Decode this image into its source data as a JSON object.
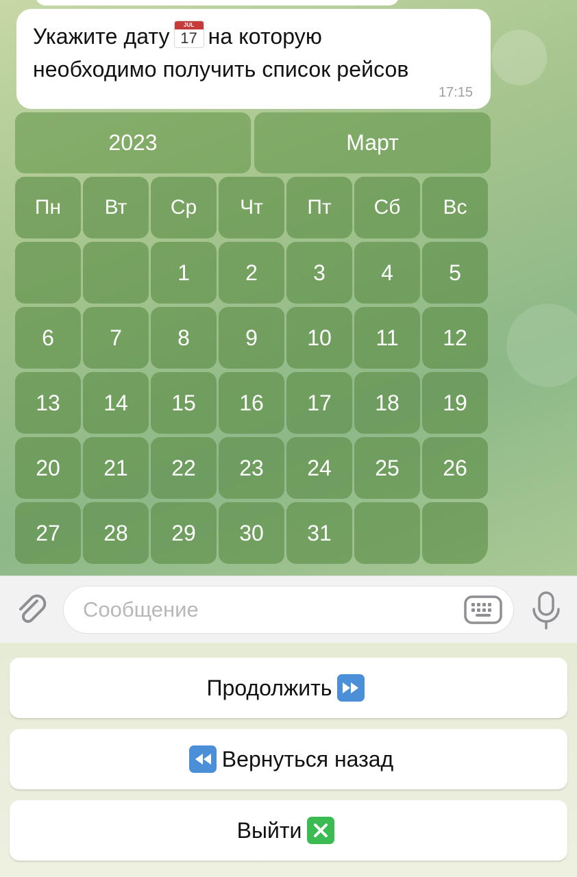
{
  "message": {
    "line1_before_emoji": "Укажите дату",
    "emoji_month": "JUL",
    "emoji_day": "17",
    "line1_after_emoji": "на которую",
    "line2": "необходимо получить список рейсов",
    "time": "17:15"
  },
  "calendar": {
    "year": "2023",
    "month": "Март",
    "weekdays": [
      "Пн",
      "Вт",
      "Ср",
      "Чт",
      "Пт",
      "Сб",
      "Вс"
    ],
    "days": [
      [
        "",
        "",
        "1",
        "2",
        "3",
        "4",
        "5"
      ],
      [
        "6",
        "7",
        "8",
        "9",
        "10",
        "11",
        "12"
      ],
      [
        "13",
        "14",
        "15",
        "16",
        "17",
        "18",
        "19"
      ],
      [
        "20",
        "21",
        "22",
        "23",
        "24",
        "25",
        "26"
      ],
      [
        "27",
        "28",
        "29",
        "30",
        "31",
        "",
        ""
      ]
    ]
  },
  "composer": {
    "placeholder": "Сообщение",
    "icons": [
      "paperclip-icon",
      "keyboard-icon",
      "microphone-icon"
    ]
  },
  "reply_keyboard": {
    "continue_label": "Продолжить",
    "continue_emoji": "fast-forward-icon",
    "back_label": "Вернуться назад",
    "back_emoji": "rewind-icon",
    "exit_label": "Выйти",
    "exit_emoji": "cross-mark-icon"
  },
  "colors": {
    "inline_button": "#6a9a58",
    "emoji_blue": "#4b8fd8",
    "emoji_green": "#3dbb53"
  }
}
